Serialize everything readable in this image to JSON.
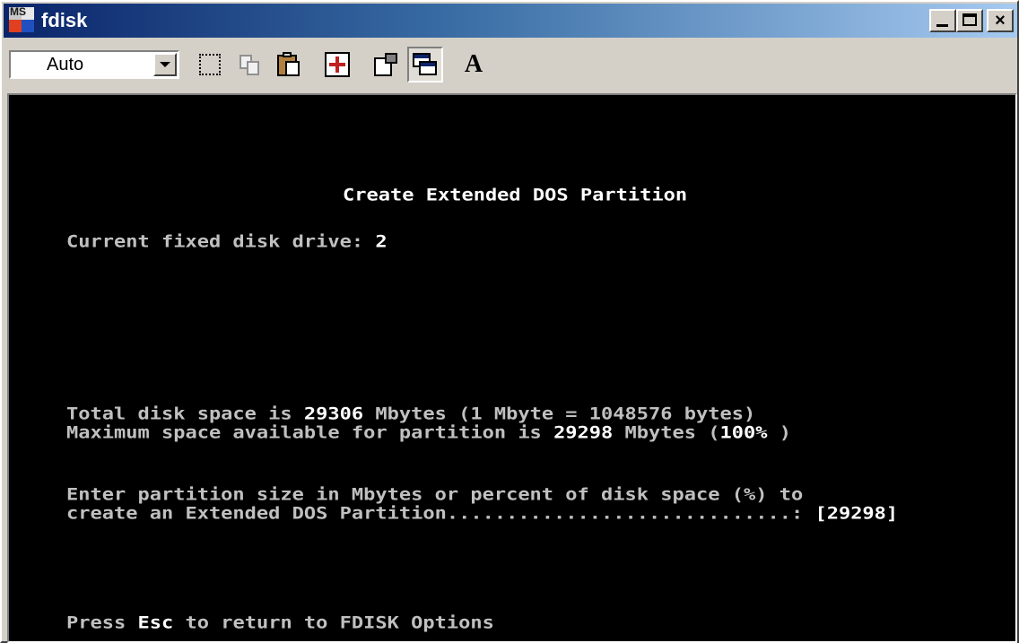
{
  "window": {
    "title": "fdisk",
    "icon": "ms-dos-icon",
    "icon_text_top": "MS",
    "icon_text_bottom": "DOS"
  },
  "title_buttons": {
    "minimize": "minimize-icon",
    "maximize": "maximize-icon",
    "close": "×"
  },
  "toolbar": {
    "font_size_value": "Auto",
    "buttons": [
      {
        "icon": "mark-icon"
      },
      {
        "icon": "copy-icon"
      },
      {
        "icon": "paste-icon"
      },
      {
        "icon": "full-screen-icon"
      },
      {
        "icon": "properties-icon"
      },
      {
        "icon": "background-icon",
        "pressed": true
      },
      {
        "icon": "font-icon",
        "label": "A"
      }
    ]
  },
  "console": {
    "heading": "Create Extended DOS Partition",
    "drive_label": "Current fixed disk drive: ",
    "drive_value": "2",
    "total_prefix": "Total disk space is ",
    "total_value": "29306",
    "total_suffix": " Mbytes (1 Mbyte = 1048576 bytes)",
    "max_prefix": "Maximum space available for partition is ",
    "max_value": "29298",
    "max_mid": " Mbytes (",
    "max_percent": "100%",
    "max_suffix": " )",
    "enter_line1": "Enter partition size in Mbytes or percent of disk space (%) to",
    "enter_line2_prefix": "create an Extended DOS Partition.............................: ",
    "enter_value": "[29298]",
    "footer_prefix": "Press ",
    "footer_key": "Esc",
    "footer_suffix": " to return to FDISK Options"
  },
  "colors": {
    "title_bar_start": "#0a246a",
    "title_bar_end": "#a6caf0",
    "console_background": "#000000",
    "console_text": "#c0c0c0",
    "console_highlight": "#ffffff",
    "chrome": "#d4d0c8"
  }
}
